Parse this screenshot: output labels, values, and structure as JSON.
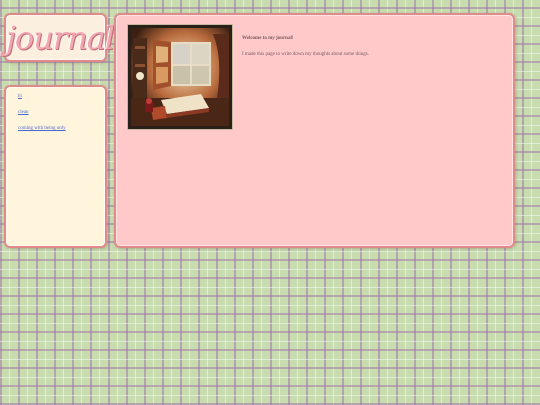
{
  "logo": {
    "text": "journal"
  },
  "nav": {
    "items": [
      {
        "label": "hi"
      },
      {
        "label": "clean"
      },
      {
        "label": "coming with being only"
      }
    ]
  },
  "main": {
    "welcome": "Welcome to my journal!",
    "intro": "I made this page to write down my thoughts about some things."
  }
}
